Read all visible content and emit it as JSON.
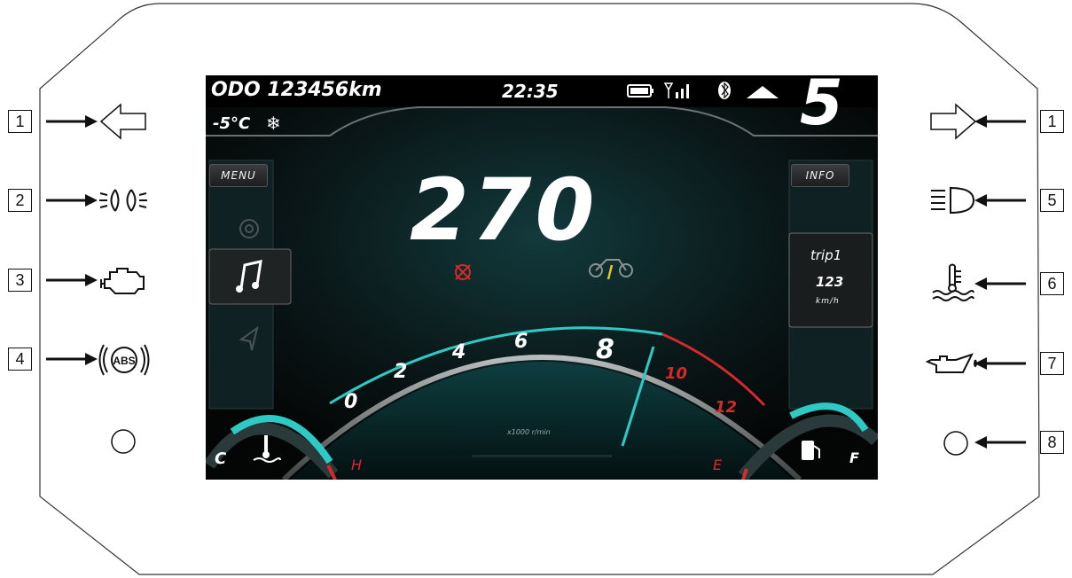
{
  "callouts": {
    "left": [
      "1",
      "2",
      "3",
      "4"
    ],
    "right": [
      "1",
      "5",
      "6",
      "7",
      "8"
    ]
  },
  "icons": {
    "left": [
      "turn-left-arrow-icon",
      "position-lights-icon",
      "engine-check-icon",
      "abs-icon",
      "round-indicator"
    ],
    "right": [
      "turn-right-arrow-icon",
      "high-beam-icon",
      "coolant-temperature-icon",
      "oil-pressure-icon",
      "round-indicator"
    ]
  },
  "status_bar": {
    "odometer": "ODO 123456km",
    "clock": "22:35",
    "temperature": "-5°C",
    "snowflake": "❄",
    "gear": "5"
  },
  "sidebar": {
    "menu_label": "MENU",
    "info_label": "INFO",
    "trip_name": "trip1",
    "trip_value": "123",
    "trip_unit": "km/h"
  },
  "speedometer": {
    "speed": "270"
  },
  "tachometer": {
    "ticks": [
      "0",
      "2",
      "4",
      "6",
      "8",
      "10",
      "12"
    ],
    "unit": "x1000 r/min",
    "needle_rpm": 9.2
  },
  "gauges": {
    "temp_cold": "C",
    "temp_hot": "H",
    "fuel_empty": "E",
    "fuel_full": "F"
  },
  "colors": {
    "accent": "#2ec9c4",
    "warning": "#d42a2a",
    "kickstand": "#e6c62a"
  }
}
